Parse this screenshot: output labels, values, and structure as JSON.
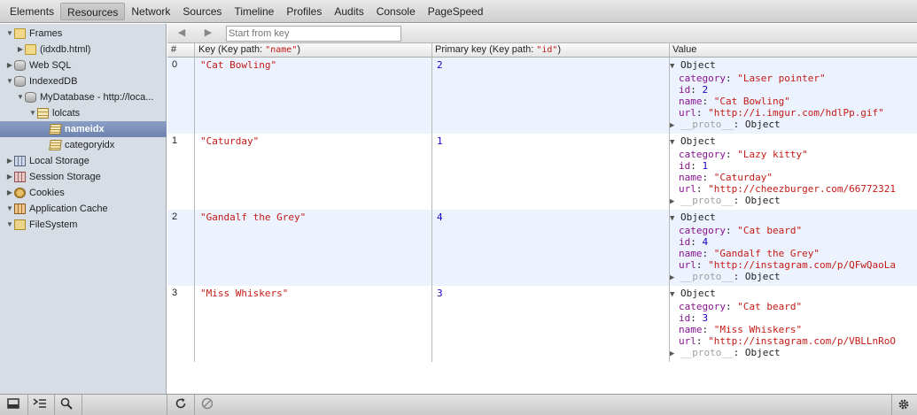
{
  "toolbar": {
    "tabs": [
      "Elements",
      "Resources",
      "Network",
      "Sources",
      "Timeline",
      "Profiles",
      "Audits",
      "Console",
      "PageSpeed"
    ],
    "active_tab": "Resources"
  },
  "sidebar": {
    "frames": "Frames",
    "frame_child": "(idxdb.html)",
    "websql": "Web SQL",
    "indexeddb": "IndexedDB",
    "database": "MyDatabase - http://loca...",
    "store": "lolcats",
    "index_selected": "nameidx",
    "index_other": "categoryidx",
    "local_storage": "Local Storage",
    "session_storage": "Session Storage",
    "cookies": "Cookies",
    "app_cache": "Application Cache",
    "filesystem": "FileSystem"
  },
  "filter": {
    "placeholder": "Start from key",
    "back": "◀",
    "forward": "▶"
  },
  "grid": {
    "col_num": "#",
    "col_key": "Key (Key path: ",
    "col_key_path": "\"name\"",
    "col_key_close": ")",
    "col_primary": "Primary key (Key path: ",
    "col_primary_path": "\"id\"",
    "col_primary_close": ")",
    "col_value": "Value",
    "rows": [
      {
        "index": "0",
        "key": "\"Cat Bowling\"",
        "primary": "2",
        "object_label": "Object",
        "category": "\"Laser pointer\"",
        "id": "2",
        "name": "\"Cat Bowling\"",
        "url": "\"http://i.imgur.com/hdlPp.gif\"",
        "proto": "__proto__",
        "proto_val": "Object"
      },
      {
        "index": "1",
        "key": "\"Caturday\"",
        "primary": "1",
        "object_label": "Object",
        "category": "\"Lazy kitty\"",
        "id": "1",
        "name": "\"Caturday\"",
        "url": "\"http://cheezburger.com/66772321",
        "proto": "__proto__",
        "proto_val": "Object"
      },
      {
        "index": "2",
        "key": "\"Gandalf the Grey\"",
        "primary": "4",
        "object_label": "Object",
        "category": "\"Cat beard\"",
        "id": "4",
        "name": "\"Gandalf the Grey\"",
        "url": "\"http://instagram.com/p/QFwQaoLa",
        "proto": "__proto__",
        "proto_val": "Object"
      },
      {
        "index": "3",
        "key": "\"Miss Whiskers\"",
        "primary": "3",
        "object_label": "Object",
        "category": "\"Cat beard\"",
        "id": "3",
        "name": "\"Miss Whiskers\"",
        "url": "\"http://instagram.com/p/VBLLnRoO",
        "proto": "__proto__",
        "proto_val": "Object"
      }
    ],
    "prop_labels": {
      "category": "category",
      "id": "id",
      "name": "name",
      "url": "url"
    }
  },
  "colors": {
    "string": "#c41a16",
    "number": "#1c00cf",
    "property": "#881391",
    "selected": "#6d84b0"
  },
  "icons": [
    "dock-icon",
    "console-drawer-icon",
    "search-icon",
    "refresh-icon",
    "clear-icon",
    "gear-icon"
  ]
}
